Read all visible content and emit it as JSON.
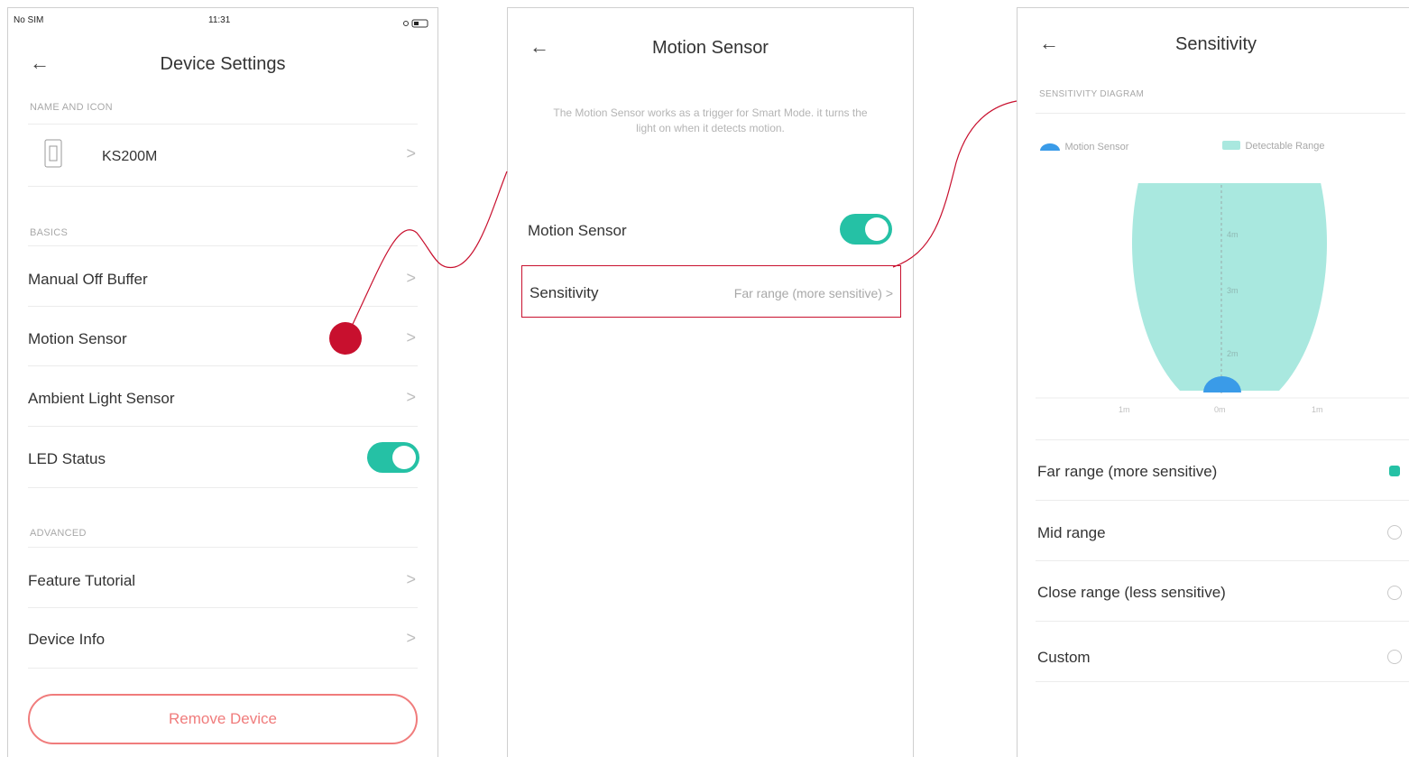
{
  "screen1": {
    "status": {
      "carrier": "No SIM",
      "time": "11:31"
    },
    "back_icon": "←",
    "title": "Device Settings",
    "section_name": "NAME AND ICON",
    "device_name": "KS200M",
    "section_basics": "BASICS",
    "items": [
      {
        "label": "Manual Off Buffer"
      },
      {
        "label": "Motion Sensor"
      },
      {
        "label": "Ambient Light Sensor"
      },
      {
        "label": "LED Status",
        "toggle": true
      }
    ],
    "section_advanced": "ADVANCED",
    "advanced_items": [
      {
        "label": "Feature Tutorial"
      },
      {
        "label": "Device Info"
      }
    ],
    "remove_button": "Remove Device",
    "chevron": ">"
  },
  "screen2": {
    "back_icon": "←",
    "title": "Motion Sensor",
    "description": "The Motion Sensor works as a trigger for Smart Mode. it turns the light on when it detects motion.",
    "motion_label": "Motion Sensor",
    "motion_enabled": true,
    "sensitivity_label": "Sensitivity",
    "sensitivity_value": "Far range (more sensitive) >"
  },
  "screen3": {
    "back_icon": "←",
    "title": "Sensitivity",
    "diagram_header": "SENSITIVITY DIAGRAM",
    "legend": [
      {
        "label": "Motion Sensor",
        "color": "#3a9be8"
      },
      {
        "label": "Detectable Range",
        "color": "#a9e8df"
      }
    ],
    "range_labels": [
      "4m",
      "3m",
      "2m"
    ],
    "x_labels": [
      "1m",
      "0m",
      "1m"
    ],
    "options": [
      {
        "label": "Far range (more sensitive)",
        "selected": true
      },
      {
        "label": "Mid range",
        "selected": false
      },
      {
        "label": "Close range (less sensitive)",
        "selected": false
      },
      {
        "label": "Custom",
        "selected": false
      }
    ]
  },
  "colors": {
    "accent": "#25c1a5",
    "annotation": "#c8102e",
    "remove": "#f07c7c"
  }
}
